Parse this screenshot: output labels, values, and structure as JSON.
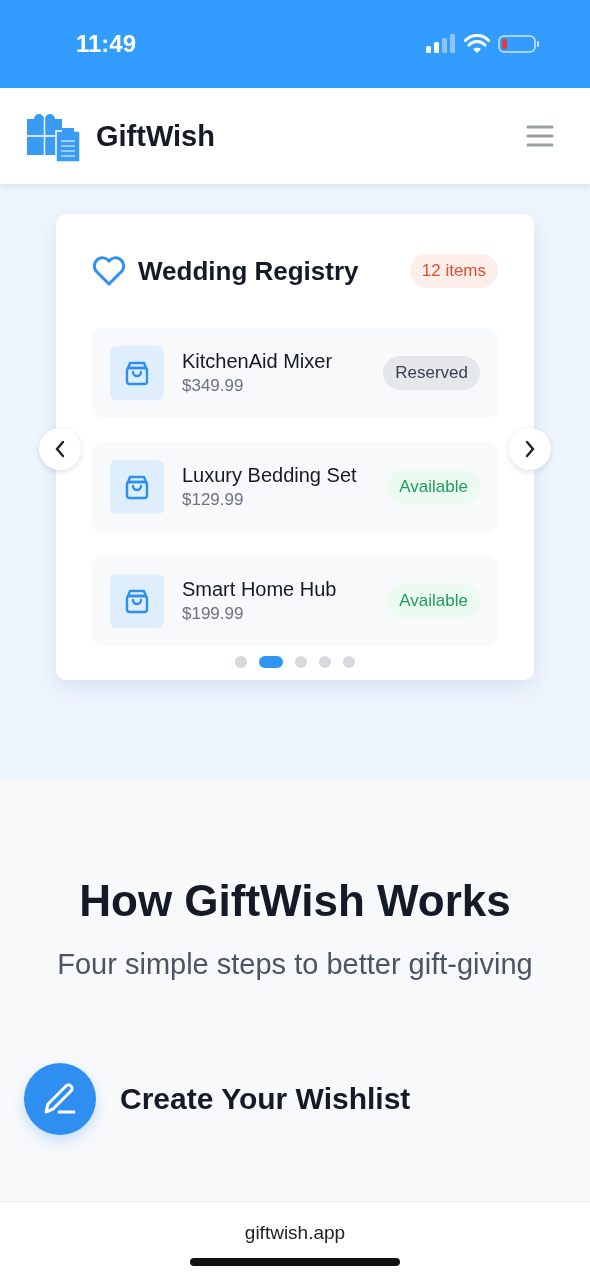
{
  "status_bar": {
    "time": "11:49"
  },
  "header": {
    "brand": "GiftWish"
  },
  "registry": {
    "title": "Wedding Registry",
    "count": "12 items",
    "items": [
      {
        "name": "KitchenAid Mixer",
        "price": "$349.99",
        "status": "Reserved",
        "kind": "reserved"
      },
      {
        "name": "Luxury Bedding Set",
        "price": "$129.99",
        "status": "Available",
        "kind": "available"
      },
      {
        "name": "Smart Home Hub",
        "price": "$199.99",
        "status": "Available",
        "kind": "available"
      }
    ],
    "dots": [
      {
        "selected": false
      },
      {
        "selected": true
      },
      {
        "selected": false
      },
      {
        "selected": false
      },
      {
        "selected": false
      }
    ]
  },
  "how": {
    "title": "How GiftWish Works",
    "subtitle": "Four simple steps to better gift-giving",
    "steps": [
      {
        "title": "Create Your Wishlist"
      }
    ]
  },
  "browser": {
    "url": "giftwish.app"
  }
}
